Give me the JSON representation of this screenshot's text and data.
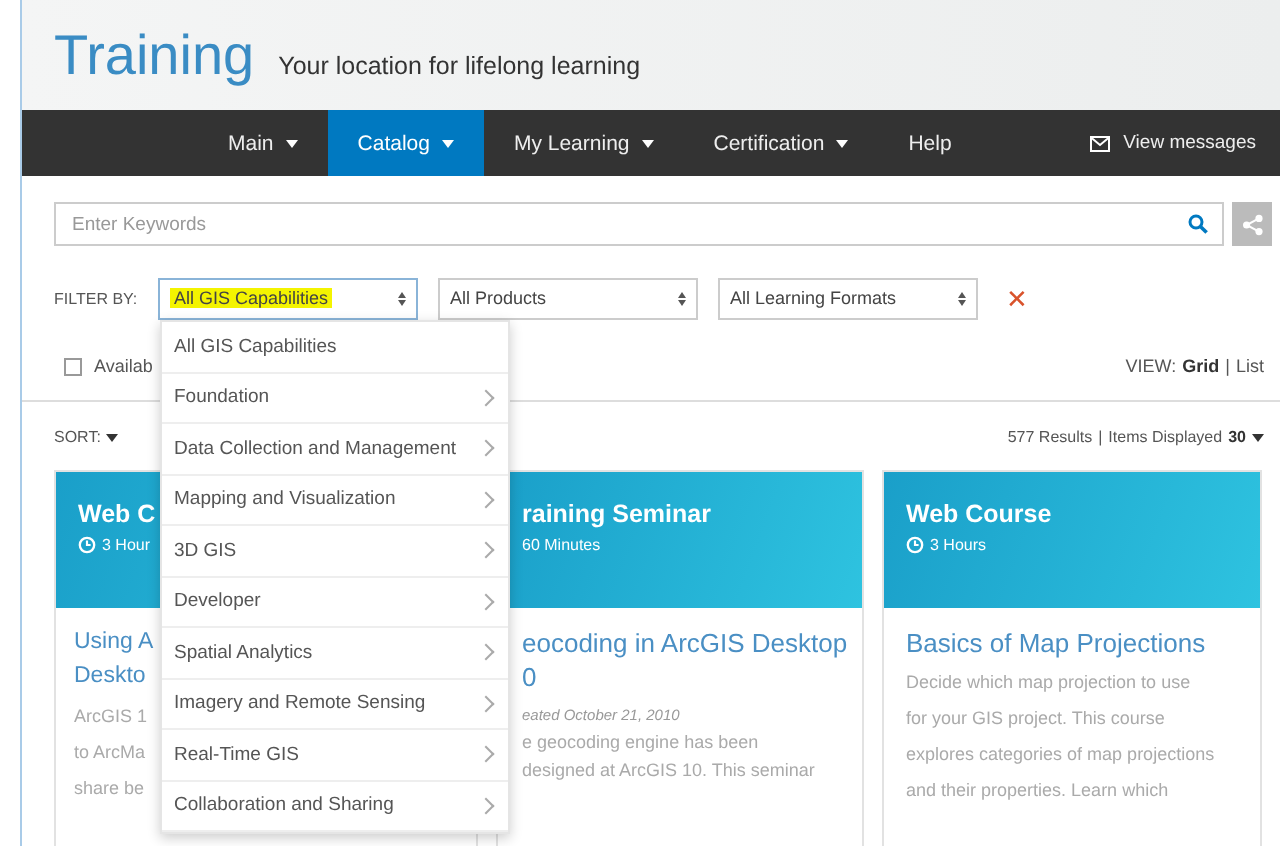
{
  "header": {
    "title": "Training",
    "tagline": "Your location for lifelong learning"
  },
  "nav": {
    "items": [
      {
        "label": "Main",
        "dropdown": true,
        "selected": false
      },
      {
        "label": "Catalog",
        "dropdown": true,
        "selected": true
      },
      {
        "label": "My Learning",
        "dropdown": true,
        "selected": false
      },
      {
        "label": "Certification",
        "dropdown": true,
        "selected": false
      },
      {
        "label": "Help",
        "dropdown": false,
        "selected": false
      }
    ],
    "messages": "View messages"
  },
  "search": {
    "placeholder": "Enter Keywords"
  },
  "filters": {
    "label": "FILTER BY:",
    "selects": [
      {
        "value": "All GIS Capabilities",
        "highlighted": true
      },
      {
        "value": "All Products",
        "highlighted": false
      },
      {
        "value": "All Learning Formats",
        "highlighted": false
      }
    ],
    "clear_icon": "✕"
  },
  "availability": {
    "label": "Availab",
    "checked": false
  },
  "view": {
    "label": "VIEW:",
    "separator": "|",
    "options": [
      {
        "label": "Grid",
        "selected": true
      },
      {
        "label": "List",
        "selected": false
      }
    ]
  },
  "sort": {
    "label": "SORT:"
  },
  "results": {
    "count": "577 Results",
    "separator": "|",
    "items_label": "Items Displayed",
    "items_value": "30"
  },
  "cards": [
    {
      "type": "Web C",
      "duration": "3 Hour",
      "clock": true,
      "title_lines": [
        "Using A",
        "Deskto"
      ],
      "description_lines": [
        "ArcGIS 1",
        "to ArcMa",
        "share be"
      ]
    },
    {
      "type": "raining Seminar",
      "duration": "60 Minutes",
      "clock": false,
      "title_lines": [
        "eocoding in ArcGIS Desktop",
        "0"
      ],
      "date": "eated October 21, 2010",
      "description_lines": [
        "e geocoding engine has been",
        "designed at ArcGIS 10. This seminar"
      ]
    },
    {
      "type": "Web Course",
      "duration": "3 Hours",
      "clock": true,
      "title_lines": [
        "Basics of Map Projections"
      ],
      "description_lines": [
        "Decide which map projection to use",
        "for your GIS project. This course",
        "explores categories of map projections",
        "and their properties. Learn which"
      ]
    }
  ],
  "dropdown": {
    "items": [
      {
        "label": "All GIS Capabilities",
        "has_submenu": false
      },
      {
        "label": "Foundation",
        "has_submenu": true
      },
      {
        "label": "Data Collection and Management",
        "has_submenu": true
      },
      {
        "label": "Mapping and Visualization",
        "has_submenu": true
      },
      {
        "label": "3D GIS",
        "has_submenu": true
      },
      {
        "label": "Developer",
        "has_submenu": true
      },
      {
        "label": "Spatial Analytics",
        "has_submenu": true
      },
      {
        "label": "Imagery and Remote Sensing",
        "has_submenu": true
      },
      {
        "label": "Real-Time GIS",
        "has_submenu": true
      },
      {
        "label": "Collaboration and Sharing",
        "has_submenu": true
      }
    ]
  }
}
